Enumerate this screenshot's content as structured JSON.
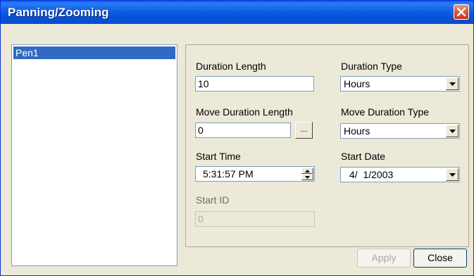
{
  "window": {
    "title": "Panning/Zooming"
  },
  "list": {
    "items": [
      "Pen1"
    ]
  },
  "form": {
    "duration_length": {
      "label": "Duration Length",
      "value": "10"
    },
    "duration_type": {
      "label": "Duration Type",
      "value": "Hours"
    },
    "move_duration_length": {
      "label": "Move Duration Length",
      "value": "0",
      "browse_label": "..."
    },
    "move_duration_type": {
      "label": "Move Duration Type",
      "value": "Hours"
    },
    "start_time": {
      "label": "Start Time",
      "value": "5:31:57 PM"
    },
    "start_date": {
      "label": "Start Date",
      "value": "4/  1/2003"
    },
    "start_id": {
      "label": "Start ID",
      "value": "0"
    }
  },
  "buttons": {
    "apply": "Apply",
    "close": "Close"
  },
  "icons": {
    "close": "close-icon",
    "dropdown": "chevron-down-icon",
    "spin_up": "spin-up-icon",
    "spin_down": "spin-down-icon"
  },
  "colors": {
    "titlebar": "#0a5fe8",
    "selection": "#316ac5",
    "face": "#ece9d8",
    "close_button": "#d9543a"
  }
}
